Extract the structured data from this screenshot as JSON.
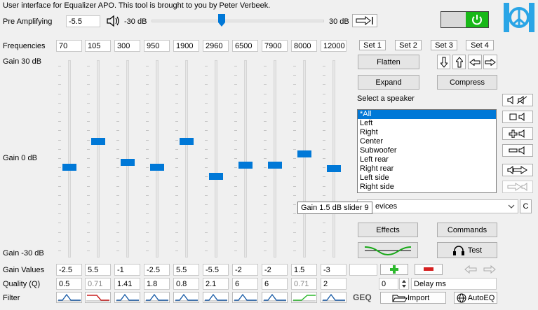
{
  "header": {
    "title": "User interface for Equalizer APO. This tool is brought to you by Peter Verbeek."
  },
  "preamp": {
    "label": "Pre Amplifying",
    "value": "-5.5",
    "min_label": "-30 dB",
    "max_label": "30 dB",
    "level": -5.5
  },
  "labels": {
    "frequencies": "Frequencies",
    "gain_top": "Gain 30 dB",
    "gain_mid": "Gain 0 dB",
    "gain_bottom": "Gain -30 dB",
    "gain_values": "Gain Values",
    "quality": "Quality (Q)",
    "filter": "Filter"
  },
  "frequencies": [
    "70",
    "105",
    "300",
    "950",
    "1900",
    "2960",
    "6500",
    "7900",
    "8000",
    "12000"
  ],
  "gains": [
    "-2.5",
    "5.5",
    "-1",
    "-2.5",
    "5.5",
    "-5.5",
    "-2",
    "-2",
    "1.5",
    "-3"
  ],
  "gain_levels": [
    -2.5,
    5.5,
    -1,
    -2.5,
    5.5,
    -5.5,
    -2,
    -2,
    1.5,
    -3
  ],
  "qualities": [
    "0.5",
    "0.71",
    "1.41",
    "1.8",
    "0.8",
    "2.1",
    "6",
    "6",
    "0.71",
    "2"
  ],
  "sets": [
    "Set 1",
    "Set 2",
    "Set 3",
    "Set 4"
  ],
  "buttons": {
    "flatten": "Flatten",
    "expand": "Expand",
    "compress": "Compress",
    "effects": "Effects",
    "commands": "Commands",
    "test": "Test",
    "import": "Import",
    "autoeq": "AutoEQ",
    "geq": "GEQ"
  },
  "speaker": {
    "label": "Select a speaker",
    "items": [
      "*All",
      "Left",
      "Right",
      "Center",
      "Subwoofer",
      "Left rear",
      "Right rear",
      "Left side",
      "Right side"
    ],
    "selected_index": 0
  },
  "device": {
    "value": "evices",
    "side_button": "C"
  },
  "tooltip": "Gain 1.5 dB slider 9",
  "delay": {
    "value": "0",
    "label": "Delay ms"
  },
  "power": {
    "state": "on",
    "color": "#18b818"
  },
  "accent": "#0078d7"
}
